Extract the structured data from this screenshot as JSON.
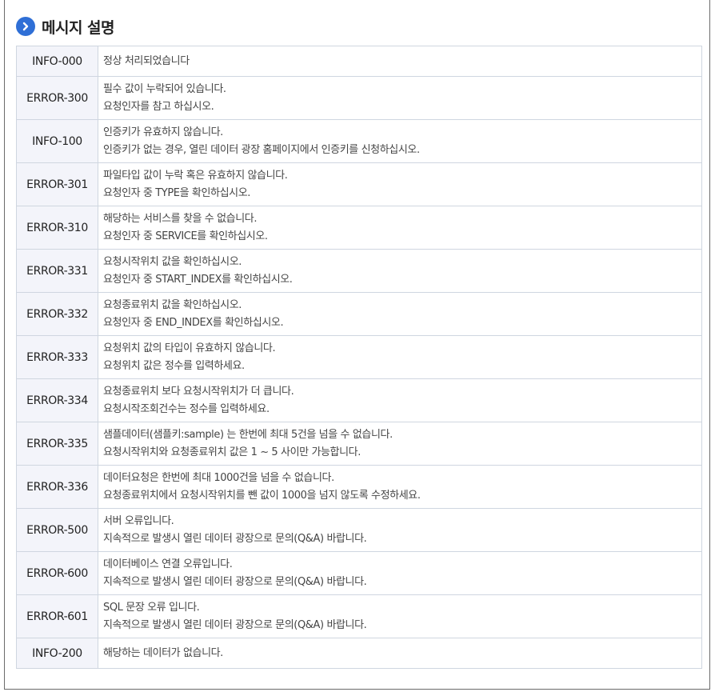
{
  "heading": {
    "title": "메시지 설명",
    "icon": "chevron-right-icon",
    "icon_color": "#2f6fd6"
  },
  "rows": [
    {
      "code": "INFO-000",
      "lines": [
        "정상 처리되었습니다"
      ]
    },
    {
      "code": "ERROR-300",
      "lines": [
        "필수 값이 누락되어 있습니다.",
        "요청인자를 참고 하십시오."
      ]
    },
    {
      "code": "INFO-100",
      "lines": [
        "인증키가 유효하지 않습니다.",
        "인증키가 없는 경우, 열린 데이터 광장 홈페이지에서 인증키를 신청하십시오."
      ]
    },
    {
      "code": "ERROR-301",
      "lines": [
        "파일타입 값이 누락 혹은 유효하지 않습니다.",
        "요청인자 중 TYPE을 확인하십시오."
      ]
    },
    {
      "code": "ERROR-310",
      "lines": [
        "해당하는 서비스를 찾을 수 없습니다.",
        "요청인자 중 SERVICE를 확인하십시오."
      ]
    },
    {
      "code": "ERROR-331",
      "lines": [
        "요청시작위치 값을 확인하십시오.",
        "요청인자 중 START_INDEX를 확인하십시오."
      ]
    },
    {
      "code": "ERROR-332",
      "lines": [
        "요청종료위치 값을 확인하십시오.",
        "요청인자 중 END_INDEX를 확인하십시오."
      ]
    },
    {
      "code": "ERROR-333",
      "lines": [
        "요청위치 값의 타입이 유효하지 않습니다.",
        "요청위치 값은 정수를 입력하세요."
      ]
    },
    {
      "code": "ERROR-334",
      "lines": [
        "요청종료위치 보다 요청시작위치가 더 큽니다.",
        "요청시작조회건수는 정수를 입력하세요."
      ]
    },
    {
      "code": "ERROR-335",
      "lines": [
        "샘플데이터(샘플키:sample) 는 한번에 최대 5건을 넘을 수 없습니다.",
        "요청시작위치와 요청종료위치 값은 1 ~ 5 사이만 가능합니다."
      ]
    },
    {
      "code": "ERROR-336",
      "lines": [
        "데이터요청은 한번에 최대 1000건을 넘을 수 없습니다.",
        "요청종료위치에서 요청시작위치를 뺀 값이 1000을 넘지 않도록 수정하세요."
      ]
    },
    {
      "code": "ERROR-500",
      "lines": [
        "서버 오류입니다.",
        "지속적으로 발생시 열린 데이터 광장으로 문의(Q&A) 바랍니다."
      ]
    },
    {
      "code": "ERROR-600",
      "lines": [
        "데이터베이스 연결 오류입니다.",
        "지속적으로 발생시 열린 데이터 광장으로 문의(Q&A) 바랍니다."
      ]
    },
    {
      "code": "ERROR-601",
      "lines": [
        "SQL 문장 오류 입니다.",
        "지속적으로 발생시 열린 데이터 광장으로 문의(Q&A) 바랍니다."
      ]
    },
    {
      "code": "INFO-200",
      "lines": [
        "해당하는 데이터가 없습니다."
      ]
    }
  ]
}
